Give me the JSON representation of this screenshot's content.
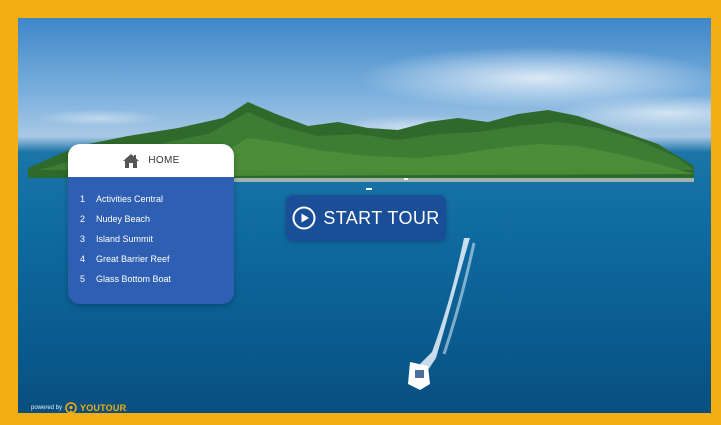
{
  "menu": {
    "home_label": "HOME",
    "home_icon": "home-icon",
    "items": [
      {
        "number": "1",
        "label": "Activities Central"
      },
      {
        "number": "2",
        "label": "Nudey Beach"
      },
      {
        "number": "3",
        "label": "Island Summit"
      },
      {
        "number": "4",
        "label": "Great Barrier Reef"
      },
      {
        "number": "5",
        "label": "Glass Bottom Boat"
      }
    ]
  },
  "start_tour": {
    "label": "START TOUR",
    "icon": "play-circle-icon"
  },
  "footer": {
    "powered_label": "powered by",
    "brand_name": "YOUTOUR",
    "brand_icon": "location-pin-icon"
  },
  "colors": {
    "frame": "#f4ae13",
    "panel": "#2f5fb3",
    "button": "#1c4896",
    "brand": "#f4ae13"
  }
}
